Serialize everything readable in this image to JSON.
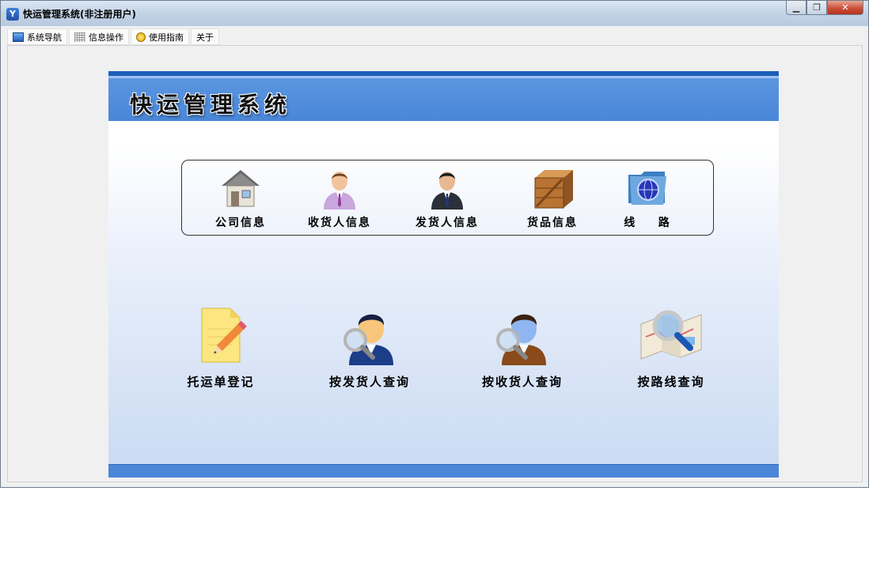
{
  "window": {
    "title": "快运管理系统(非注册用户)",
    "controls": {
      "minimize": "▁",
      "restore": "❐",
      "close": "✕"
    }
  },
  "menu": {
    "tabs": [
      {
        "label": "系统导航",
        "icon": "system-nav-icon"
      },
      {
        "label": "信息操作",
        "icon": "grid-icon"
      },
      {
        "label": "使用指南",
        "icon": "guide-icon"
      },
      {
        "label": "关于",
        "icon": ""
      }
    ]
  },
  "banner": {
    "title": "快运管理系统"
  },
  "info_section": {
    "items": [
      {
        "label": "公司信息",
        "icon": "house-icon"
      },
      {
        "label": "收货人信息",
        "icon": "receiver-person-icon"
      },
      {
        "label": "发货人信息",
        "icon": "sender-person-icon"
      },
      {
        "label": "货品信息",
        "icon": "wooden-crate-icon"
      },
      {
        "label": "线    路",
        "icon": "globe-folder-icon"
      }
    ]
  },
  "actions": {
    "items": [
      {
        "label": "托运单登记",
        "icon": "notepad-pencil-icon"
      },
      {
        "label": "按发货人查询",
        "icon": "user-magnifier-icon"
      },
      {
        "label": "按收货人查询",
        "icon": "user-magnifier-icon"
      },
      {
        "label": "按路线查询",
        "icon": "map-magnifier-icon"
      }
    ]
  },
  "colors": {
    "banner": "#4a87d8",
    "banner_dark": "#1a5fb8",
    "close_button": "#c9513a"
  }
}
